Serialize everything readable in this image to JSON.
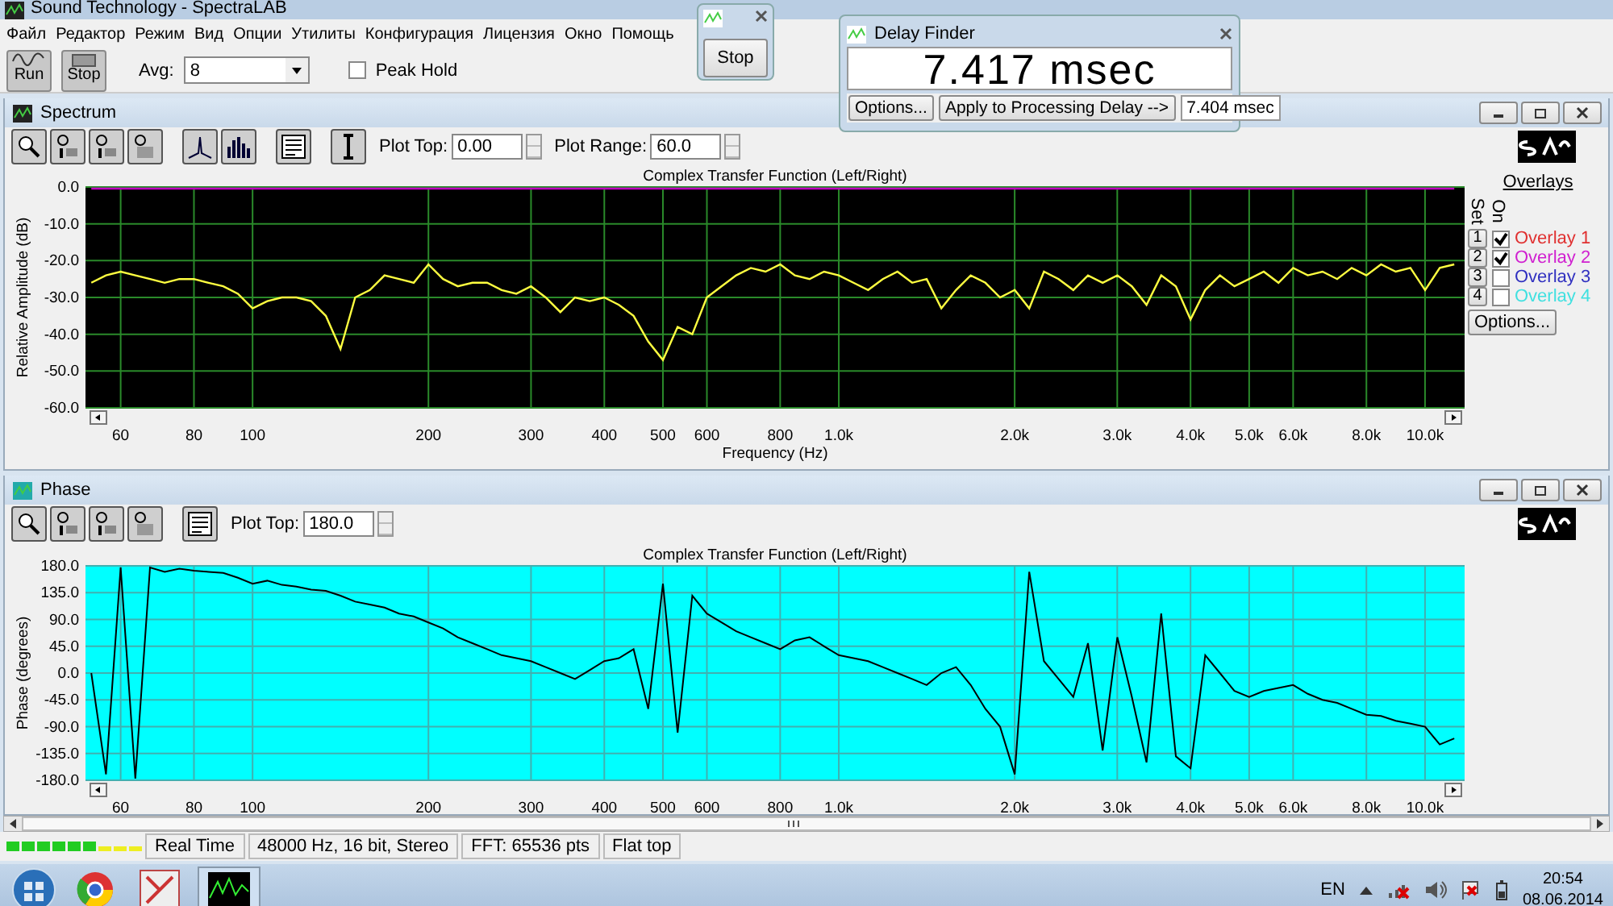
{
  "window": {
    "title": "Sound Technology - SpectraLAB"
  },
  "menu": [
    "Файл",
    "Редактор",
    "Режим",
    "Вид",
    "Опции",
    "Утилиты",
    "Конфигурация",
    "Лицензия",
    "Окно",
    "Помощь"
  ],
  "toolbar": {
    "run": "Run",
    "stop": "Stop",
    "avg_label": "Avg:",
    "avg_value": "8",
    "peak_hold": {
      "label": "Peak Hold",
      "checked": false
    }
  },
  "stop_window": {
    "button": "Stop"
  },
  "delay_finder": {
    "title": "Delay Finder",
    "reading": "7.417 msec",
    "options": "Options...",
    "apply": "Apply to Processing Delay -->",
    "applied": "7.404 msec"
  },
  "panels": [
    {
      "title": "Spectrum",
      "kind": "spectrum",
      "fields": [
        {
          "label": "Plot Top:",
          "value": "0.00"
        },
        {
          "label": "Plot Range:",
          "value": "60.0"
        }
      ],
      "chart_data": {
        "type": "line",
        "title": "Complex Transfer Function (Left/Right)",
        "xlabel": "Frequency (Hz)",
        "ylabel": "Relative Amplitude (dB)",
        "grid": true,
        "ylim": [
          -60,
          0
        ],
        "categories": [
          null,
          null,
          "60",
          null,
          null,
          null,
          null,
          "80",
          null,
          null,
          null,
          "100",
          null,
          null,
          null,
          null,
          null,
          null,
          null,
          null,
          null,
          null,
          null,
          "200",
          null,
          null,
          null,
          null,
          null,
          null,
          "300",
          null,
          null,
          null,
          null,
          "400",
          null,
          null,
          null,
          "500",
          null,
          null,
          "600",
          null,
          null,
          null,
          null,
          "800",
          null,
          null,
          null,
          "1.0k",
          null,
          null,
          null,
          null,
          null,
          null,
          null,
          null,
          null,
          null,
          null,
          "2.0k",
          null,
          null,
          null,
          null,
          null,
          null,
          "3.0k",
          null,
          null,
          null,
          null,
          "4.0k",
          null,
          null,
          null,
          "5.0k",
          null,
          null,
          "6.0k",
          null,
          null,
          null,
          null,
          "8.0k",
          null,
          null,
          null,
          "10.0k",
          null,
          null
        ],
        "yticks": [
          {
            "value": 0,
            "label": "0.0"
          },
          {
            "value": -10,
            "label": "-10.0"
          },
          {
            "value": -20,
            "label": "-20.0"
          },
          {
            "value": -30,
            "label": "-30.0"
          },
          {
            "value": -40,
            "label": "-40.0"
          },
          {
            "value": -50,
            "label": "-50.0"
          },
          {
            "value": -60,
            "label": "-60.0"
          }
        ],
        "series": [
          {
            "color": "#ffff40",
            "values": [
              -26,
              -24,
              -23,
              -24,
              -25,
              -26,
              -25,
              -25,
              -26,
              -27,
              -29,
              -33,
              -31,
              -30,
              -30,
              -31,
              -35,
              -44,
              -30,
              -28,
              -24,
              -25,
              -26,
              -21,
              -25,
              -27,
              -26,
              -26,
              -28,
              -29,
              -27,
              -30,
              -34,
              -30,
              -31,
              -30,
              -32,
              -35,
              -42,
              -47,
              -38,
              -40,
              -30,
              -27,
              -24,
              -22,
              -23,
              -21,
              -24,
              -25,
              -23,
              -24,
              -26,
              -28,
              -25,
              -23,
              -26,
              -25,
              -33,
              -28,
              -24,
              -26,
              -30,
              -28,
              -33,
              -23,
              -25,
              -28,
              -24,
              -26,
              -24,
              -27,
              -32,
              -24,
              -27,
              -36,
              -28,
              -24,
              -27,
              -25,
              -23,
              -26,
              -22,
              -24,
              -23,
              -25,
              -22,
              -24,
              -21,
              -23,
              -22,
              -28,
              -22,
              -21
            ]
          },
          {
            "color": "#c000c0",
            "values": [
              0,
              0,
              0,
              0,
              0,
              0,
              0,
              0,
              0,
              0,
              0,
              0,
              0,
              0,
              0,
              0,
              0,
              0,
              0,
              0,
              0,
              0,
              0,
              0,
              0,
              0,
              0,
              0,
              0,
              0,
              0,
              0,
              0,
              0,
              0,
              0,
              0,
              0,
              0,
              0,
              0,
              0,
              0,
              0,
              0,
              0,
              0,
              0,
              0,
              0,
              0,
              0,
              0,
              0,
              0,
              0,
              0,
              0,
              0,
              0,
              0,
              0,
              0,
              0,
              0,
              0,
              0,
              0,
              0,
              0,
              0,
              0,
              0,
              0,
              0,
              0,
              0,
              0,
              0,
              0,
              0,
              0,
              0,
              0,
              0,
              0,
              0,
              0,
              0,
              0,
              0,
              0,
              0,
              0
            ]
          }
        ]
      },
      "overlays": {
        "title": "Overlays",
        "set_label": "Set",
        "on_label": "On",
        "options": "Options...",
        "items": [
          {
            "set": "1",
            "label": "Overlay 1",
            "checked": true,
            "color": "#e03030"
          },
          {
            "set": "2",
            "label": "Overlay 2",
            "checked": true,
            "color": "#d020d0"
          },
          {
            "set": "3",
            "label": "Overlay 3",
            "checked": false,
            "color": "#3030c0"
          },
          {
            "set": "4",
            "label": "Overlay 4",
            "checked": false,
            "color": "#40e0e0"
          }
        ]
      }
    },
    {
      "title": "Phase",
      "kind": "phase",
      "fields": [
        {
          "label": "Plot Top:",
          "value": "180.0"
        }
      ],
      "chart_data": {
        "type": "line",
        "title": "Complex Transfer Function (Left/Right)",
        "ylabel": "Phase (degrees)",
        "grid": true,
        "ylim": [
          -180,
          180
        ],
        "categories": [
          null,
          null,
          "60",
          null,
          null,
          null,
          null,
          "80",
          null,
          null,
          null,
          "100",
          null,
          null,
          null,
          null,
          null,
          null,
          null,
          null,
          null,
          null,
          null,
          "200",
          null,
          null,
          null,
          null,
          null,
          null,
          "300",
          null,
          null,
          null,
          null,
          "400",
          null,
          null,
          null,
          "500",
          null,
          null,
          "600",
          null,
          null,
          null,
          null,
          "800",
          null,
          null,
          null,
          "1.0k",
          null,
          null,
          null,
          null,
          null,
          null,
          null,
          null,
          null,
          null,
          null,
          "2.0k",
          null,
          null,
          null,
          null,
          null,
          null,
          "3.0k",
          null,
          null,
          null,
          null,
          "4.0k",
          null,
          null,
          null,
          "5.0k",
          null,
          null,
          "6.0k",
          null,
          null,
          null,
          null,
          "8.0k",
          null,
          null,
          null,
          "10.0k",
          null,
          null
        ],
        "yticks": [
          {
            "value": 180,
            "label": "180.0"
          },
          {
            "value": 135,
            "label": "135.0"
          },
          {
            "value": 90,
            "label": "90.0"
          },
          {
            "value": 45,
            "label": "45.0"
          },
          {
            "value": 0,
            "label": "0.0"
          },
          {
            "value": -45,
            "label": "-45.0"
          },
          {
            "value": -90,
            "label": "-90.0"
          },
          {
            "value": -135,
            "label": "-135.0"
          },
          {
            "value": -180,
            "label": "-180.0"
          }
        ],
        "series": [
          {
            "color": "#000000",
            "values": [
              0,
              -170,
              180,
              -180,
              180,
              170,
              175,
              172,
              170,
              168,
              160,
              150,
              155,
              148,
              145,
              140,
              138,
              130,
              120,
              115,
              110,
              100,
              95,
              85,
              75,
              60,
              50,
              40,
              30,
              25,
              20,
              10,
              0,
              -10,
              5,
              20,
              25,
              40,
              -60,
              150,
              -100,
              130,
              100,
              85,
              70,
              60,
              50,
              40,
              55,
              60,
              45,
              30,
              25,
              20,
              10,
              0,
              -10,
              -20,
              0,
              10,
              -20,
              -60,
              -90,
              -170,
              170,
              20,
              -10,
              -40,
              50,
              -130,
              60,
              -40,
              -150,
              100,
              -140,
              -160,
              30,
              0,
              -30,
              -40,
              -30,
              -25,
              -20,
              -35,
              -45,
              -50,
              -60,
              -70,
              -72,
              -80,
              -85,
              -90,
              -120,
              -110
            ]
          }
        ]
      }
    }
  ],
  "status_bar": {
    "fields": [
      "Real Time",
      "48000 Hz, 16 bit, Stereo",
      "FFT: 65536 pts",
      "Flat top"
    ]
  },
  "taskbar": {
    "language": "EN",
    "time": "20:54",
    "date": "08.06.2014"
  }
}
